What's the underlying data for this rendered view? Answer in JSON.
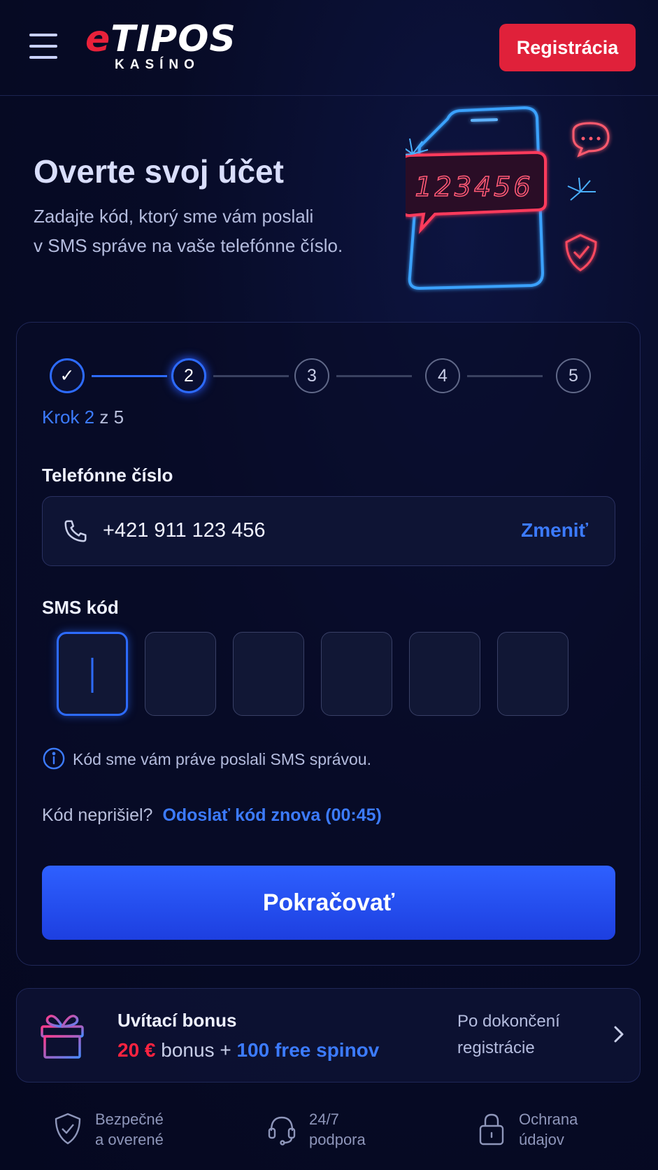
{
  "header": {
    "logo_e": "e",
    "logo_rest": "TIPOS",
    "logo_sub": "KASÍNO",
    "register_label": "Registrácia"
  },
  "hero": {
    "title": "Overte svoj účet",
    "subtitle_line1": "Zadajte kód, ktorý sme vám poslali",
    "subtitle_line2": "v SMS správe na vaše telefónne číslo.",
    "illustration_code": "123456"
  },
  "stepper": {
    "steps": [
      "✓",
      "2",
      "3",
      "4",
      "5"
    ],
    "current": 2,
    "total": 5,
    "label_prefix": "Krok 2",
    "label_suffix": "z 5"
  },
  "phone": {
    "label": "Telefónne číslo",
    "value": "+421 911 123 456",
    "change_label": "Zmeniť"
  },
  "sms": {
    "label": "SMS kód",
    "digits": [
      "",
      "",
      "",
      "",
      "",
      ""
    ],
    "info_text": "Kód sme vám práve poslali SMS správou.",
    "resend_question": "Kód neprišiel?",
    "resend_link": "Odoslať kód znova (00:45)"
  },
  "continue_label": "Pokračovať",
  "bonus": {
    "title": "Uvítací bonus",
    "amount": "20 €",
    "mid": "bonus +",
    "spins": "100 free spinov",
    "note_line1": "Po dokončení",
    "note_line2": "registrácie"
  },
  "trust": [
    {
      "line1": "Bezpečné",
      "line2": "a overené",
      "icon": "shield-check-icon"
    },
    {
      "line1": "24/7",
      "line2": "podpora",
      "icon": "headset-icon"
    },
    {
      "line1": "Ochrana",
      "line2": "údajov",
      "icon": "lock-icon"
    }
  ],
  "colors": {
    "accent_blue": "#2d6bff",
    "brand_red": "#e0213a",
    "background": "#070b26"
  }
}
